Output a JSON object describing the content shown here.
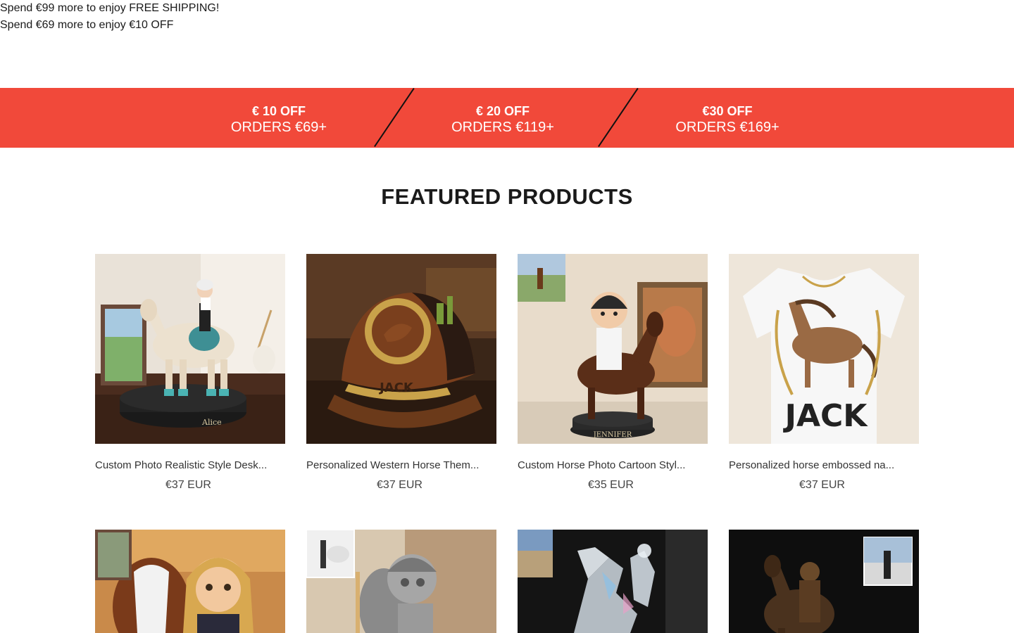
{
  "promo": {
    "shipping_line": "Spend €99 more to enjoy FREE SHIPPING!",
    "discount_line": "Spend €69 more to enjoy €10 OFF"
  },
  "discount_tiers": [
    {
      "title": "€ 10 OFF",
      "subtitle": "ORDERS €69+"
    },
    {
      "title": "€ 20 OFF",
      "subtitle": "ORDERS €119+"
    },
    {
      "title": "€30 OFF",
      "subtitle": "ORDERS €169+"
    }
  ],
  "colors": {
    "banner": "#f1493a",
    "banner_text": "#ffffff",
    "divider": "#111111"
  },
  "section": {
    "title": "FEATURED PRODUCTS"
  },
  "products": [
    {
      "title": "Custom Photo Realistic Style Desk...",
      "price": "€37 EUR",
      "image_text": "Alice"
    },
    {
      "title": "Personalized Western Horse Them...",
      "price": "€37 EUR",
      "image_text": "JACK"
    },
    {
      "title": "Custom Horse Photo Cartoon Styl...",
      "price": "€35 EUR",
      "image_text": "JENNIFER"
    },
    {
      "title": "Personalized horse embossed na...",
      "price": "€37 EUR",
      "image_text": "JACK"
    },
    {
      "title": "",
      "price": ""
    },
    {
      "title": "",
      "price": ""
    },
    {
      "title": "",
      "price": ""
    },
    {
      "title": "",
      "price": ""
    }
  ]
}
